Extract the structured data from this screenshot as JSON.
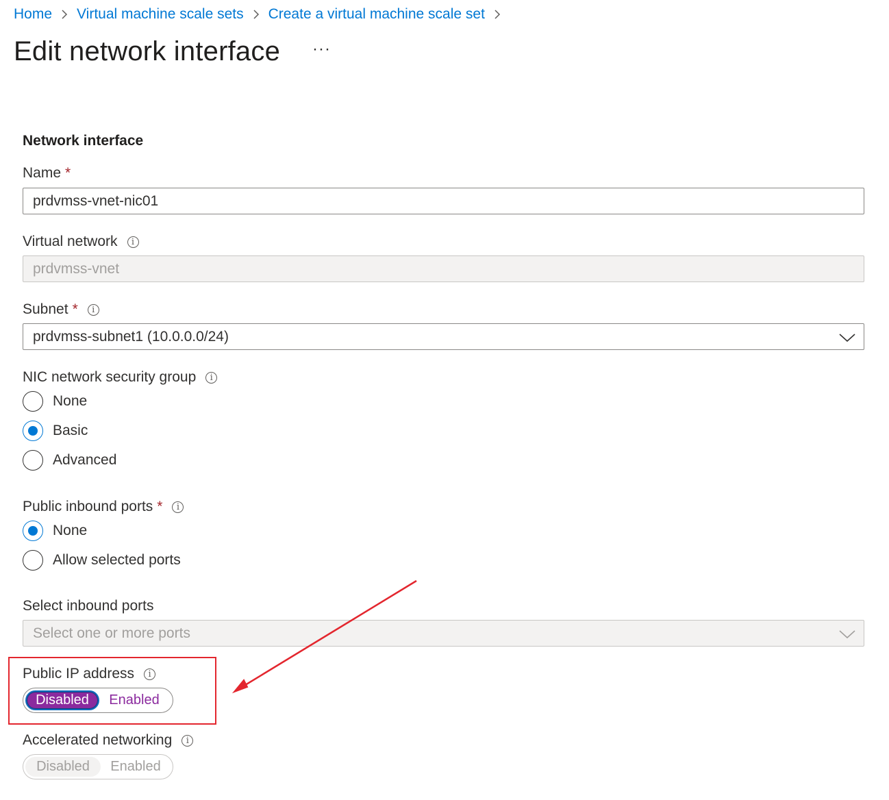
{
  "breadcrumb": [
    {
      "label": "Home"
    },
    {
      "label": "Virtual machine scale sets"
    },
    {
      "label": "Create a virtual machine scale set"
    }
  ],
  "page_title": "Edit network interface",
  "more_label": "···",
  "section_title": "Network interface",
  "name": {
    "label": "Name",
    "required": "*",
    "value": "prdvmss-vnet-nic01"
  },
  "virtual_network": {
    "label": "Virtual network",
    "value": "prdvmss-vnet"
  },
  "subnet": {
    "label": "Subnet",
    "required": "*",
    "value": "prdvmss-subnet1 (10.0.0.0/24)"
  },
  "nic_nsg": {
    "label": "NIC network security group",
    "options": [
      "None",
      "Basic",
      "Advanced"
    ],
    "selected": "Basic"
  },
  "public_inbound_ports": {
    "label": "Public inbound ports",
    "required": "*",
    "options": [
      "None",
      "Allow selected ports"
    ],
    "selected": "None"
  },
  "select_inbound_ports": {
    "label": "Select inbound ports",
    "placeholder": "Select one or more ports"
  },
  "public_ip": {
    "label": "Public IP address",
    "options": [
      "Disabled",
      "Enabled"
    ],
    "selected": "Disabled"
  },
  "accelerated_networking": {
    "label": "Accelerated networking",
    "options": [
      "Disabled",
      "Enabled"
    ],
    "selected": "Disabled"
  },
  "info_glyph": "i",
  "colors": {
    "link": "#0078d4",
    "accent": "#8b2a9e",
    "required": "#a4262c",
    "annotation": "#e3262e"
  }
}
